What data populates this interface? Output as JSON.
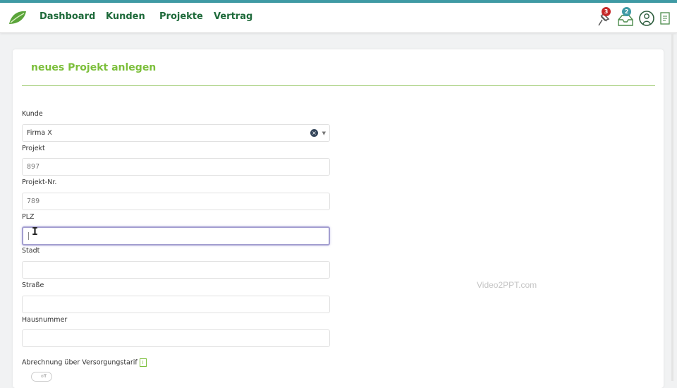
{
  "nav": {
    "links": [
      "Dashboard",
      "Kunden",
      "Projekte",
      "Vertrag"
    ],
    "icons": {
      "notifications": {
        "name": "pin-notification-icon",
        "count": "3",
        "color": "#c62828"
      },
      "messages": {
        "name": "inbox-icon",
        "count": "2",
        "color": "#3f9aa5"
      },
      "profile": {
        "name": "user-icon"
      },
      "document": {
        "name": "document-icon"
      }
    },
    "colors": {
      "link": "#1e6a3a",
      "accent": "#7cbf3b"
    }
  },
  "form": {
    "title": "neues Projekt anlegen",
    "fields": {
      "kunde": {
        "label": "Kunde",
        "value": "Firma X"
      },
      "projekt": {
        "label": "Projekt",
        "value": "897"
      },
      "projekt_nr": {
        "label": "Projekt-Nr.",
        "value": "789"
      },
      "plz": {
        "label": "PLZ",
        "value": ""
      },
      "stadt": {
        "label": "Stadt",
        "value": ""
      },
      "strasse": {
        "label": "Straße",
        "value": ""
      },
      "hausnummer": {
        "label": "Hausnummer",
        "value": ""
      },
      "abrechnung": {
        "label": "Abrechnung über Versorgungstarif",
        "info": "i",
        "toggle": "off"
      }
    }
  },
  "watermark": "Video2PPT.com"
}
